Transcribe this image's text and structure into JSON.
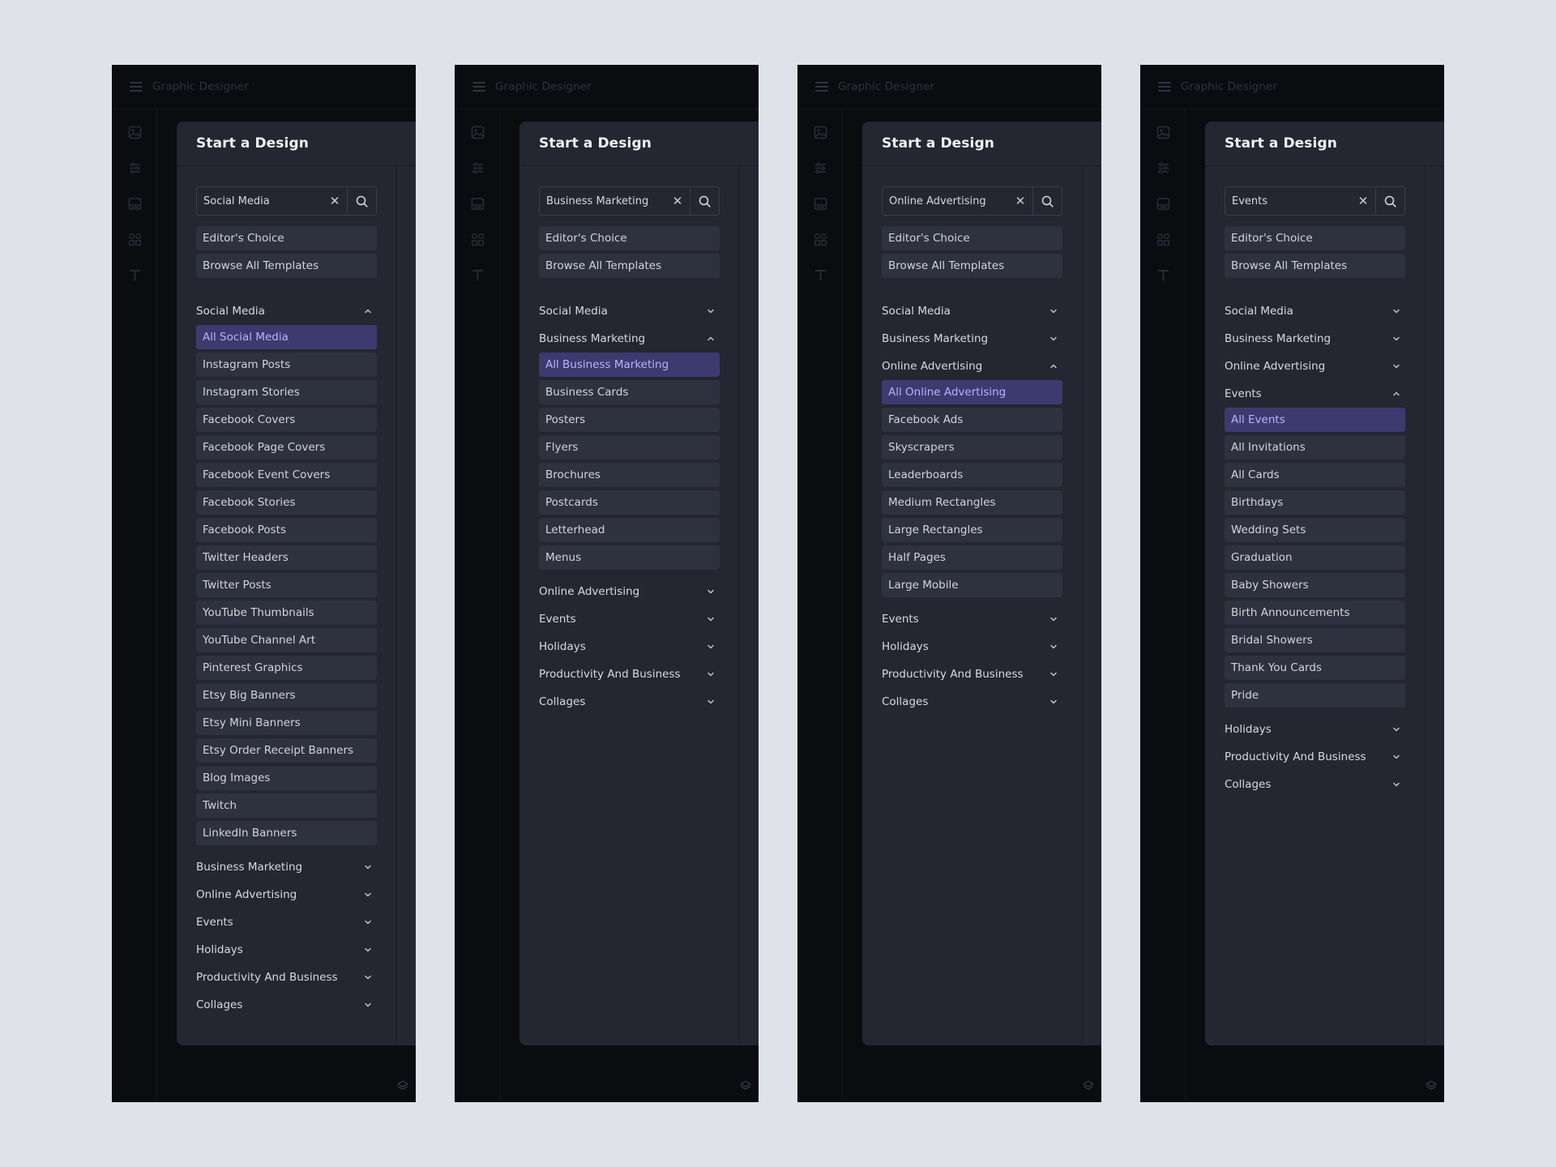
{
  "app_title": "Graphic Designer",
  "panel_title": "Start a Design",
  "quick_links": [
    "Editor's Choice",
    "Browse All Templates"
  ],
  "colors": {
    "background": "#dfe2e9",
    "screen": "#0b0c10",
    "panel": "#242631",
    "item": "#2e313e",
    "active_item": "#3c3a6e",
    "active_text": "#b9b2ff"
  },
  "icons": {
    "menu": "hamburger-icon",
    "clear": "close-icon",
    "search": "search-icon",
    "expanded": "chevron-up-icon",
    "collapsed": "chevron-down-icon",
    "layers": "layers-icon"
  },
  "screens": [
    {
      "search_value": "Social Media",
      "categories": [
        {
          "label": "Social Media",
          "expanded": true,
          "items": [
            "All Social Media",
            "Instagram Posts",
            "Instagram Stories",
            "Facebook Covers",
            "Facebook Page Covers",
            "Facebook Event Covers",
            "Facebook Stories",
            "Facebook Posts",
            "Twitter Headers",
            "Twitter Posts",
            "YouTube Thumbnails",
            "YouTube Channel Art",
            "Pinterest Graphics",
            "Etsy Big Banners",
            "Etsy Mini Banners",
            "Etsy Order Receipt Banners",
            "Blog Images",
            "Twitch",
            "LinkedIn Banners"
          ]
        },
        {
          "label": "Business Marketing",
          "expanded": false
        },
        {
          "label": "Online Advertising",
          "expanded": false
        },
        {
          "label": "Events",
          "expanded": false
        },
        {
          "label": "Holidays",
          "expanded": false
        },
        {
          "label": "Productivity And Business",
          "expanded": false
        },
        {
          "label": "Collages",
          "expanded": false
        }
      ]
    },
    {
      "search_value": "Business Marketing",
      "categories": [
        {
          "label": "Social Media",
          "expanded": false
        },
        {
          "label": "Business Marketing",
          "expanded": true,
          "items": [
            "All Business Marketing",
            "Business Cards",
            "Posters",
            "Flyers",
            "Brochures",
            "Postcards",
            "Letterhead",
            "Menus"
          ]
        },
        {
          "label": "Online Advertising",
          "expanded": false
        },
        {
          "label": "Events",
          "expanded": false
        },
        {
          "label": "Holidays",
          "expanded": false
        },
        {
          "label": "Productivity And Business",
          "expanded": false
        },
        {
          "label": "Collages",
          "expanded": false
        }
      ]
    },
    {
      "search_value": "Online Advertising",
      "categories": [
        {
          "label": "Social Media",
          "expanded": false
        },
        {
          "label": "Business Marketing",
          "expanded": false
        },
        {
          "label": "Online Advertising",
          "expanded": true,
          "items": [
            "All Online Advertising",
            "Facebook Ads",
            "Skyscrapers",
            "Leaderboards",
            "Medium Rectangles",
            "Large Rectangles",
            "Half Pages",
            "Large Mobile"
          ]
        },
        {
          "label": "Events",
          "expanded": false
        },
        {
          "label": "Holidays",
          "expanded": false
        },
        {
          "label": "Productivity And Business",
          "expanded": false
        },
        {
          "label": "Collages",
          "expanded": false
        }
      ]
    },
    {
      "search_value": "Events",
      "categories": [
        {
          "label": "Social Media",
          "expanded": false
        },
        {
          "label": "Business Marketing",
          "expanded": false
        },
        {
          "label": "Online Advertising",
          "expanded": false
        },
        {
          "label": "Events",
          "expanded": true,
          "items": [
            "All Events",
            "All Invitations",
            "All Cards",
            "Birthdays",
            "Wedding Sets",
            "Graduation",
            "Baby Showers",
            "Birth Announcements",
            "Bridal Showers",
            "Thank You Cards",
            "Pride"
          ]
        },
        {
          "label": "Holidays",
          "expanded": false
        },
        {
          "label": "Productivity And Business",
          "expanded": false
        },
        {
          "label": "Collages",
          "expanded": false
        }
      ]
    }
  ]
}
